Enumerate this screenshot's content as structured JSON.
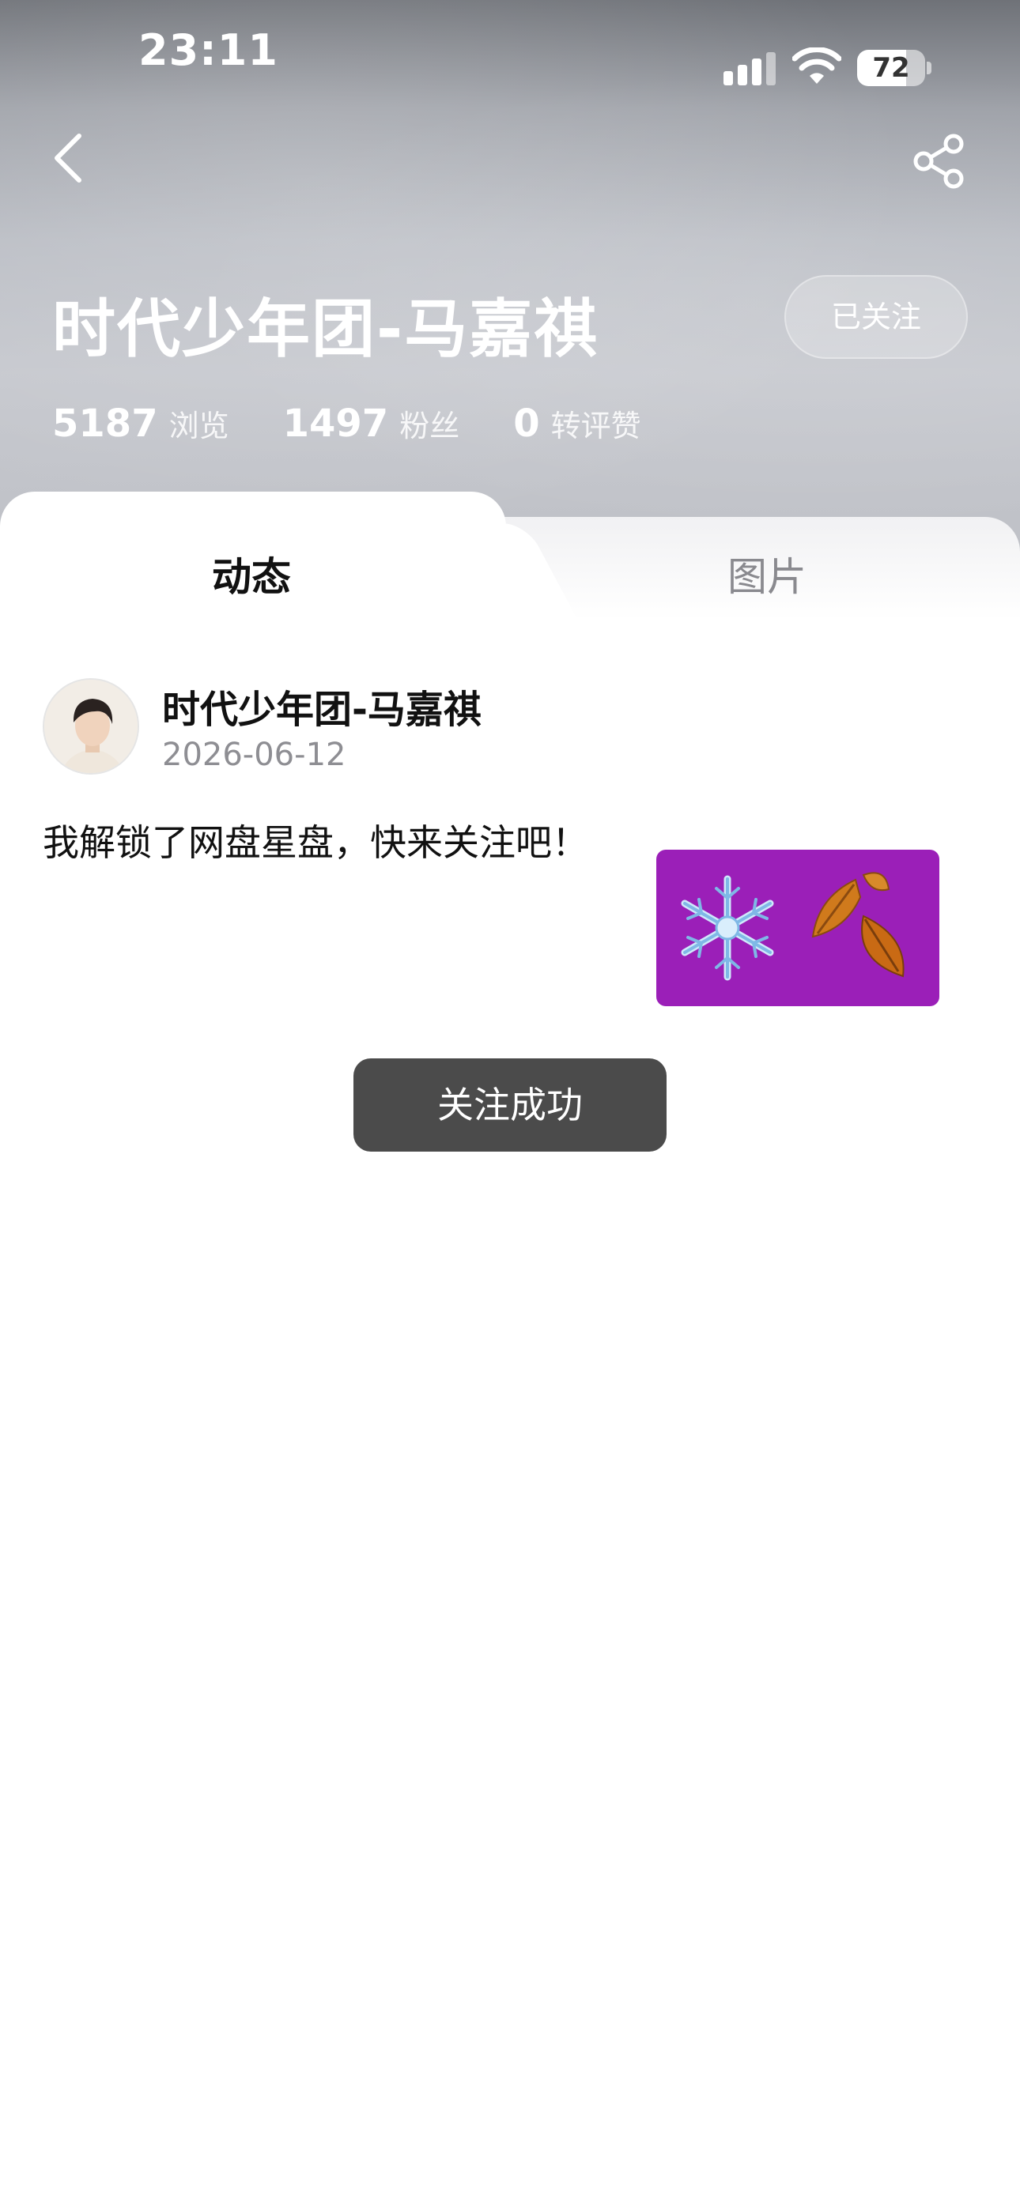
{
  "status_bar": {
    "time": "23:11",
    "battery_level": "72",
    "battery_fraction": 0.72
  },
  "header": {
    "title": "时代少年团-马嘉祺",
    "follow_button_label": "已关注",
    "stats": [
      {
        "value": "5187",
        "label": "浏览"
      },
      {
        "value": "1497",
        "label": "粉丝"
      },
      {
        "value": "0",
        "label": "转评赞"
      }
    ]
  },
  "tabs": [
    {
      "label": "动态",
      "active": true
    },
    {
      "label": "图片",
      "active": false
    }
  ],
  "post": {
    "author": "时代少年团-马嘉祺",
    "date": "2026-06-12",
    "text": "我解锁了网盘星盘，快来关注吧！",
    "image_icons": [
      "snowflake-icon",
      "fallen-leaves-icon"
    ],
    "image_bg_color": "#9b1fb8"
  },
  "toast": {
    "message": "关注成功"
  },
  "icons": {
    "back": "chevron-left-icon",
    "share": "share-icon"
  }
}
